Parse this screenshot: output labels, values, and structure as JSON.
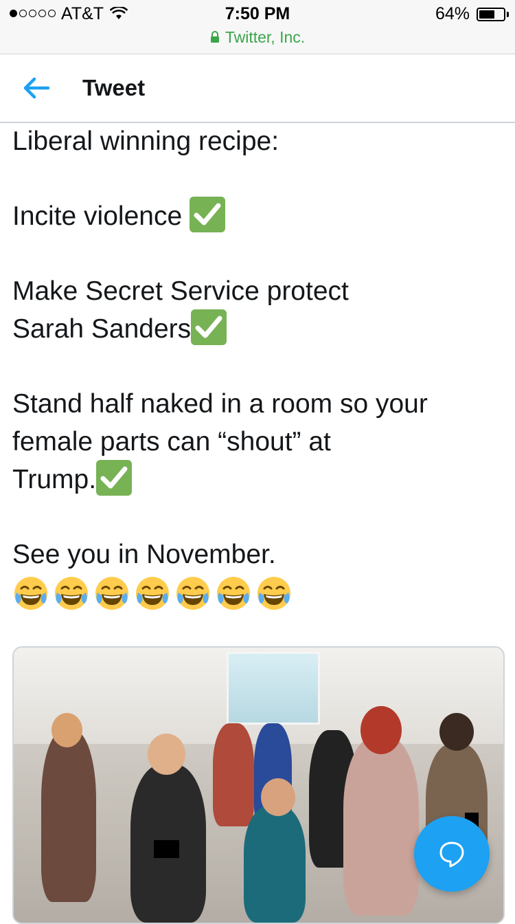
{
  "status_bar": {
    "carrier": "AT&T",
    "time": "7:50 PM",
    "battery_percent": "64%",
    "battery_level": 0.64,
    "signal_bars_filled": 1,
    "signal_bars_total": 5,
    "url_label": "Twitter, Inc."
  },
  "header": {
    "title": "Tweet",
    "back_icon": "arrow-left-icon"
  },
  "tweet": {
    "line1": "Liberal winning recipe:",
    "line2": "Incite violence ",
    "line3": "Make Secret Service protect",
    "line4": "Sarah Sanders",
    "line5": "Stand half naked in a room so your",
    "line6": "female parts can “shout” at",
    "line7": "Trump.",
    "line8": "See you in November.",
    "check_icon": "white-check-mark-emoji",
    "laugh_icon": "face-with-tears-of-joy-emoji",
    "laugh_count": 7
  },
  "media": {
    "type": "photo"
  },
  "fab": {
    "icon": "reply-bubble-icon"
  },
  "colors": {
    "twitter_blue": "#1da1f2",
    "secure_green": "#3aa54a",
    "check_green": "#77b255"
  }
}
